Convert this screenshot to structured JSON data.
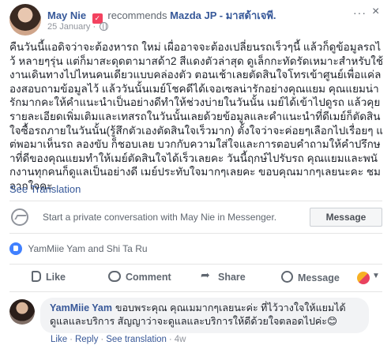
{
  "post": {
    "author": "May Nie",
    "action": "recommends",
    "page": "Mazda JP - มาสด้าเจพี.",
    "date": "25 January",
    "more_label": "···",
    "close_label": "×",
    "text": "คืนวันนี้แอดิจว่าจะต้องหารถ ใหม่ เผื่ออาจจะต้องเปลี่ยนรถเร็วๆนี้ แล้วก็ดูข้อมูลรถไว้ หลายๆรุ่น แต่ก็มาสะดุดตามาสด้า2 สีแดงตัวล่าสุด ดูเล็กกะทัดรัดเหมาะสำหรับใช้งานเดินทางไปไหนคนเดียวแบบคล่องตัว ตอนเช้าเลยตัดสินใจโทรเข้าศูนย์เพื่อแค่ลองสอบถามข้อมูลไว้ แล้ววันนั้นเมย์โชคดีได้เจอเซลน่ารักอย่างคุณแยม คุณแยมน่ารักมากคะให้คำแนะนำเป็นอย่างดีทำให้ช่วงบ่ายในวันนั้น เมย์ได้เข้าไปดูรถ แล้วคุยรายละเอียดเพิ่มเติมและเทสรถในวันนั้นเลยด้วยข้อมูลและคำแนะนำที่ดีเมย์ก็ตัดสินใจซื้อรถภายในวันนั้น(รู้สึกตัวเองตัดสินใจเร็วมาก) ตั้งใจว่าจะค่อยๆเลือกไปเรื่อยๆ แต่พอมาเห็นรถ ลองขับ ก็ชอบเลย บวกกับความใส่ใจและการตอบคำถามให้คำปรึกษาที่ดีของคุณแยมทำให้เมย์ตัดสินใจได้เร็วเลยคะ วันนี้ฤกษ์ไปรับรถ คุณแยมและพนักงานทุกคนก็ดูแลเป็นอย่างดี เมย์ประทับใจมากๆเลยคะ ขอบคุณมากๆเลยนะคะ ชมจากใจคะ",
    "see_translation": "See Translation"
  },
  "messenger": {
    "placeholder": "Start a private conversation with May Nie in Messenger.",
    "button_label": "Message"
  },
  "reactions": {
    "names": "YamMiie Yam and Shi Ta Ru"
  },
  "actions": {
    "like": "Like",
    "comment": "Comment",
    "share": "Share",
    "message": "Message"
  },
  "comment": {
    "author": "YamMiie Yam",
    "text": "ขอบพระคุณ คุณเมมากๆเลยนะค่ะ ที่ไว้วางใจให้แยมได้ดูแลและบริการ สัญญาว่าจะดูแลและบริการให้ดีด้วยใจตลอดไปค่ะ😊",
    "like": "Like",
    "reply": "Reply",
    "see_translation": "See translation",
    "time": "4w"
  }
}
